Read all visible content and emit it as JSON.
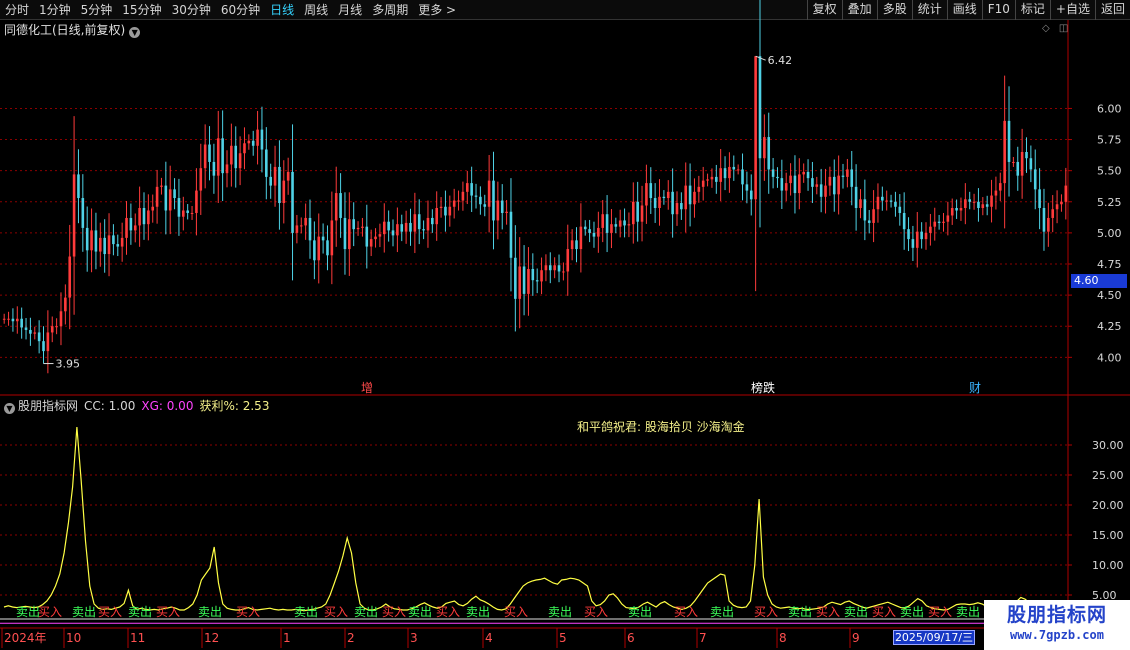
{
  "toolbar": {
    "periods": [
      "分时",
      "1分钟",
      "5分钟",
      "15分钟",
      "30分钟",
      "60分钟",
      "日线",
      "周线",
      "月线",
      "多周期",
      "更多 >"
    ],
    "active_period": "日线",
    "right_buttons": [
      "复权",
      "叠加",
      "多股",
      "统计",
      "画线",
      "F10",
      "标记",
      "+自选",
      "返回"
    ]
  },
  "stock": {
    "title": "同德化工(日线,前复权)",
    "high_label": "6.42",
    "low_label": "3.95",
    "current_price": "4.60",
    "price_ticks": [
      "6.00",
      "5.75",
      "5.50",
      "5.25",
      "5.00",
      "4.75",
      "4.50",
      "4.25",
      "4.00"
    ],
    "markers": [
      {
        "text": "增",
        "color": "#ff4a4a"
      },
      {
        "text": "榜跌",
        "color": "#ffffff"
      },
      {
        "text": "财",
        "color": "#3ab4ff"
      }
    ]
  },
  "indicator": {
    "name": "股朋指标网",
    "params": [
      {
        "text": "CC: 1.00",
        "color": "#d6d6d6"
      },
      {
        "text": "XG: 0.00",
        "color": "#ff44ff"
      },
      {
        "text": "获利%: 2.53",
        "color": "#f4f08a"
      }
    ],
    "slogan": "和平鸽祝君:  股海拾贝  沙海淘金",
    "ticks": [
      "30.00",
      "25.00",
      "20.00",
      "15.00",
      "10.00",
      "5.00"
    ],
    "buy_label": "买入",
    "sell_label": "卖出"
  },
  "xaxis": {
    "labels": [
      "2024年",
      "10",
      "11",
      "12",
      "1",
      "2",
      "3",
      "4",
      "5",
      "6",
      "7",
      "8",
      "9"
    ],
    "cursor_date": "2025/09/17/三"
  },
  "watermark": {
    "name": "股朋指标网",
    "url": "www.7gpzb.com"
  },
  "colors": {
    "up": "#ff3b3b",
    "down": "#4fd2e6",
    "grid": "#8b0000",
    "axis": "#b00000",
    "profit": "#ffff44"
  },
  "chart_data": {
    "type": "candlestick",
    "series": [
      {
        "name": "价格",
        "values": [
          4.31,
          4.31,
          4.29,
          4.31,
          4.24,
          4.22,
          4.19,
          4.2,
          4.13,
          4.05,
          4.2,
          4.25,
          4.25,
          4.37,
          4.48,
          4.81,
          5.47,
          5.28,
          5.04,
          4.86,
          5.02,
          4.85,
          4.96,
          4.83,
          4.98,
          4.91,
          4.89,
          4.96,
          5.12,
          5.02,
          5.06,
          5.2,
          5.07,
          5.18,
          5.21,
          5.37,
          5.38,
          5.18,
          5.35,
          5.28,
          5.13,
          5.18,
          5.16,
          5.16,
          5.34,
          5.52,
          5.71,
          5.57,
          5.46,
          5.76,
          5.48,
          5.55,
          5.7,
          5.52,
          5.64,
          5.72,
          5.74,
          5.7,
          5.83,
          5.67,
          5.45,
          5.38,
          5.53,
          5.24,
          5.42,
          5.49,
          5.0,
          5.06,
          5.06,
          5.12,
          4.94,
          4.78,
          4.97,
          4.94,
          4.82,
          5.1,
          5.32,
          5.12,
          4.87,
          5.11,
          5.03,
          5.04,
          5.05,
          4.89,
          4.95,
          4.97,
          4.99,
          5.09,
          5.02,
          4.98,
          5.07,
          5.01,
          5.08,
          5.01,
          5.15,
          5.03,
          5.02,
          5.12,
          5.07,
          5.2,
          5.21,
          5.14,
          5.21,
          5.26,
          5.26,
          5.33,
          5.4,
          5.3,
          5.29,
          5.23,
          5.21,
          5.42,
          5.1,
          5.26,
          5.16,
          5.17,
          4.8,
          4.47,
          4.73,
          4.51,
          4.71,
          4.62,
          4.61,
          4.7,
          4.74,
          4.7,
          4.74,
          4.69,
          4.69,
          4.87,
          4.94,
          4.87,
          5.05,
          5.03,
          5.0,
          4.97,
          5.04,
          5.15,
          5.0,
          5.07,
          5.05,
          5.1,
          5.06,
          5.07,
          5.25,
          5.09,
          5.22,
          5.4,
          5.28,
          5.2,
          5.29,
          5.28,
          5.33,
          5.15,
          5.24,
          5.19,
          5.38,
          5.23,
          5.33,
          5.37,
          5.42,
          5.43,
          5.45,
          5.41,
          5.52,
          5.44,
          5.53,
          5.51,
          5.51,
          5.39,
          5.34,
          5.27,
          6.42,
          5.6,
          5.77,
          5.51,
          5.45,
          5.44,
          5.34,
          5.4,
          5.46,
          5.32,
          5.47,
          5.49,
          5.44,
          5.37,
          5.39,
          5.29,
          5.38,
          5.45,
          5.31,
          5.46,
          5.45,
          5.51,
          5.37,
          5.2,
          5.27,
          5.1,
          5.08,
          5.19,
          5.29,
          5.26,
          5.26,
          5.25,
          5.21,
          5.16,
          5.03,
          4.95,
          4.88,
          5.01,
          4.95,
          5.0,
          5.05,
          5.09,
          5.08,
          5.09,
          5.14,
          5.2,
          5.18,
          5.2,
          5.27,
          5.25,
          5.25,
          5.2,
          5.23,
          5.21,
          5.3,
          5.34,
          5.4,
          5.9,
          5.57,
          5.57,
          5.46,
          5.65,
          5.6,
          5.51,
          5.35,
          5.2,
          5.01,
          5.12,
          5.19,
          5.23,
          5.25,
          5.38
        ]
      },
      {
        "name": "获利%",
        "values": [
          3.0,
          3.2,
          3.0,
          2.9,
          3.0,
          3.1,
          3.0,
          2.9,
          3.0,
          3.4,
          4.0,
          5.0,
          6.5,
          8.5,
          12.0,
          17.0,
          23.0,
          33.0,
          24.0,
          14.0,
          6.5,
          3.5,
          2.8,
          2.6,
          2.7,
          2.6,
          2.8,
          3.0,
          3.6,
          5.8,
          3.2,
          2.6,
          2.8,
          2.6,
          2.5,
          2.6,
          2.5,
          2.7,
          2.8,
          3.0,
          2.8,
          2.5,
          2.5,
          2.9,
          3.5,
          5.0,
          7.5,
          8.5,
          9.5,
          13.0,
          7.0,
          3.5,
          2.8,
          2.6,
          2.5,
          2.5,
          2.7,
          2.9,
          2.6,
          2.5,
          2.6,
          2.7,
          2.8,
          2.6,
          2.5,
          2.6,
          2.5,
          2.5,
          2.6,
          2.5,
          2.4,
          2.5,
          2.6,
          2.8,
          3.0,
          3.5,
          5.0,
          7.0,
          9.0,
          11.5,
          14.5,
          12.0,
          7.0,
          3.5,
          2.8,
          2.5,
          2.5,
          2.7,
          3.0,
          3.5,
          3.0,
          2.7,
          2.6,
          2.5,
          2.5,
          2.7,
          3.0,
          3.4,
          3.7,
          3.3,
          3.0,
          2.8,
          3.0,
          3.6,
          3.8,
          4.0,
          3.4,
          3.2,
          3.6,
          4.3,
          4.8,
          4.2,
          3.9,
          3.5,
          3.0,
          2.6,
          2.5,
          2.7,
          3.5,
          4.5,
          5.5,
          6.5,
          7.0,
          7.3,
          7.5,
          7.6,
          7.8,
          7.4,
          7.0,
          6.8,
          7.5,
          7.6,
          7.8,
          7.7,
          7.5,
          7.0,
          6.5,
          4.0,
          3.2,
          3.4,
          4.0,
          5.0,
          5.2,
          4.5,
          3.5,
          2.9,
          2.8,
          2.7,
          3.0,
          3.5,
          3.8,
          3.4,
          3.0,
          3.6,
          3.9,
          3.4,
          3.0,
          2.8,
          2.6,
          2.8,
          3.2,
          4.0,
          5.0,
          6.0,
          7.0,
          7.5,
          8.0,
          8.5,
          8.3,
          4.0,
          3.3,
          3.0,
          2.9,
          3.0,
          4.0,
          10.0,
          21.0,
          8.0,
          5.0,
          3.5,
          3.0,
          2.8,
          2.9,
          3.0,
          2.8,
          2.7,
          2.8,
          2.6,
          2.6,
          2.7,
          2.8,
          3.0,
          3.5,
          3.8,
          3.6,
          3.4,
          3.8,
          4.0,
          3.6,
          3.3,
          3.0,
          2.8,
          3.0,
          3.2,
          3.4,
          3.6,
          3.8,
          3.5,
          3.2,
          2.9,
          2.8,
          3.2,
          3.8,
          4.4,
          4.0,
          3.2,
          2.9,
          2.7,
          2.6,
          2.5,
          2.6,
          3.0,
          3.4,
          3.5,
          3.5,
          3.4,
          3.5,
          3.7,
          3.5,
          3.1,
          3.0,
          3.4,
          3.6,
          3.5,
          3.3,
          3.2,
          3.9,
          4.6,
          4.3,
          3.7,
          3.2,
          2.9,
          2.7,
          2.5,
          2.4,
          2.6,
          2.8,
          2.7,
          2.5
        ]
      }
    ],
    "ylim": [
      3.85,
      6.55
    ],
    "y2lim": [
      0,
      35
    ]
  }
}
